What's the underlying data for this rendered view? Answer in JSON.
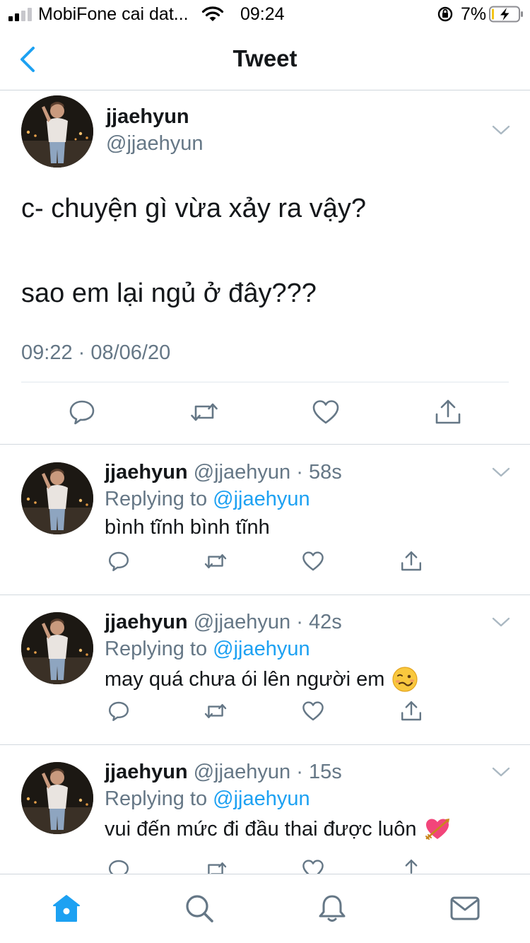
{
  "status_bar": {
    "carrier": "MobiFone cai dat...",
    "time": "09:24",
    "battery": "7%"
  },
  "nav": {
    "title": "Tweet",
    "back_icon": "chevron-left-icon"
  },
  "main_tweet": {
    "name": "jjaehyun",
    "handle": "@jjaehyun",
    "text_line1": "c- chuyện gì vừa xảy ra vậy?",
    "text_line2": "sao em lại ngủ ở đây???",
    "timestamp": "09:22 · 08/06/20"
  },
  "replies": [
    {
      "name": "jjaehyun",
      "handle": "@jjaehyun",
      "time": "58s",
      "replying_prefix": "Replying to",
      "replying_to": "@jjaehyun",
      "text": "bình tĩnh bình tĩnh",
      "emoji": ""
    },
    {
      "name": "jjaehyun",
      "handle": "@jjaehyun",
      "time": "42s",
      "replying_prefix": "Replying to",
      "replying_to": "@jjaehyun",
      "text": "may quá chưa ói lên người em",
      "emoji": "😵"
    },
    {
      "name": "jjaehyun",
      "handle": "@jjaehyun",
      "time": "15s",
      "replying_prefix": "Replying to",
      "replying_to": "@jjaehyun",
      "text": "vui đến mức đi đầu thai được luôn",
      "emoji": "💘"
    }
  ],
  "actions": [
    "reply-icon",
    "retweet-icon",
    "like-icon",
    "share-icon"
  ],
  "tab_bar": [
    "home-icon",
    "search-icon",
    "notifications-icon",
    "messages-icon"
  ],
  "colors": {
    "accent": "#1da1f2",
    "text": "#14171a",
    "secondary": "#657786",
    "divider": "#e1e8ed"
  }
}
